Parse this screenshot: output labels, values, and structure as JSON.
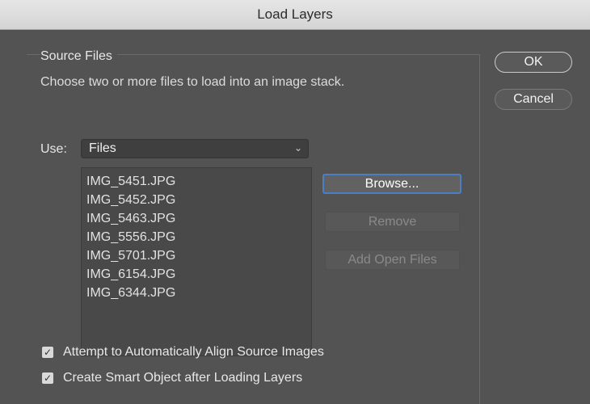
{
  "window": {
    "title": "Load Layers"
  },
  "source_files": {
    "group_title": "Source Files",
    "instruction": "Choose two or more files to load into an image stack.",
    "use_label": "Use:",
    "use_value": "Files",
    "files": [
      "IMG_5451.JPG",
      "IMG_5452.JPG",
      "IMG_5463.JPG",
      "IMG_5556.JPG",
      "IMG_5701.JPG",
      "IMG_6154.JPG",
      "IMG_6344.JPG"
    ],
    "buttons": {
      "browse": "Browse...",
      "remove": "Remove",
      "add_open_files": "Add Open Files"
    }
  },
  "options": {
    "auto_align": {
      "label": "Attempt to Automatically Align Source Images",
      "checked": true
    },
    "smart_object": {
      "label": "Create Smart Object after Loading Layers",
      "checked": true
    }
  },
  "actions": {
    "ok": "OK",
    "cancel": "Cancel"
  },
  "colors": {
    "accent_focus": "#4a7fc6",
    "dialog_bg": "#535353"
  },
  "icons": {
    "select_arrow": "chevron-down-icon",
    "checkmark": "checkmark-icon"
  }
}
